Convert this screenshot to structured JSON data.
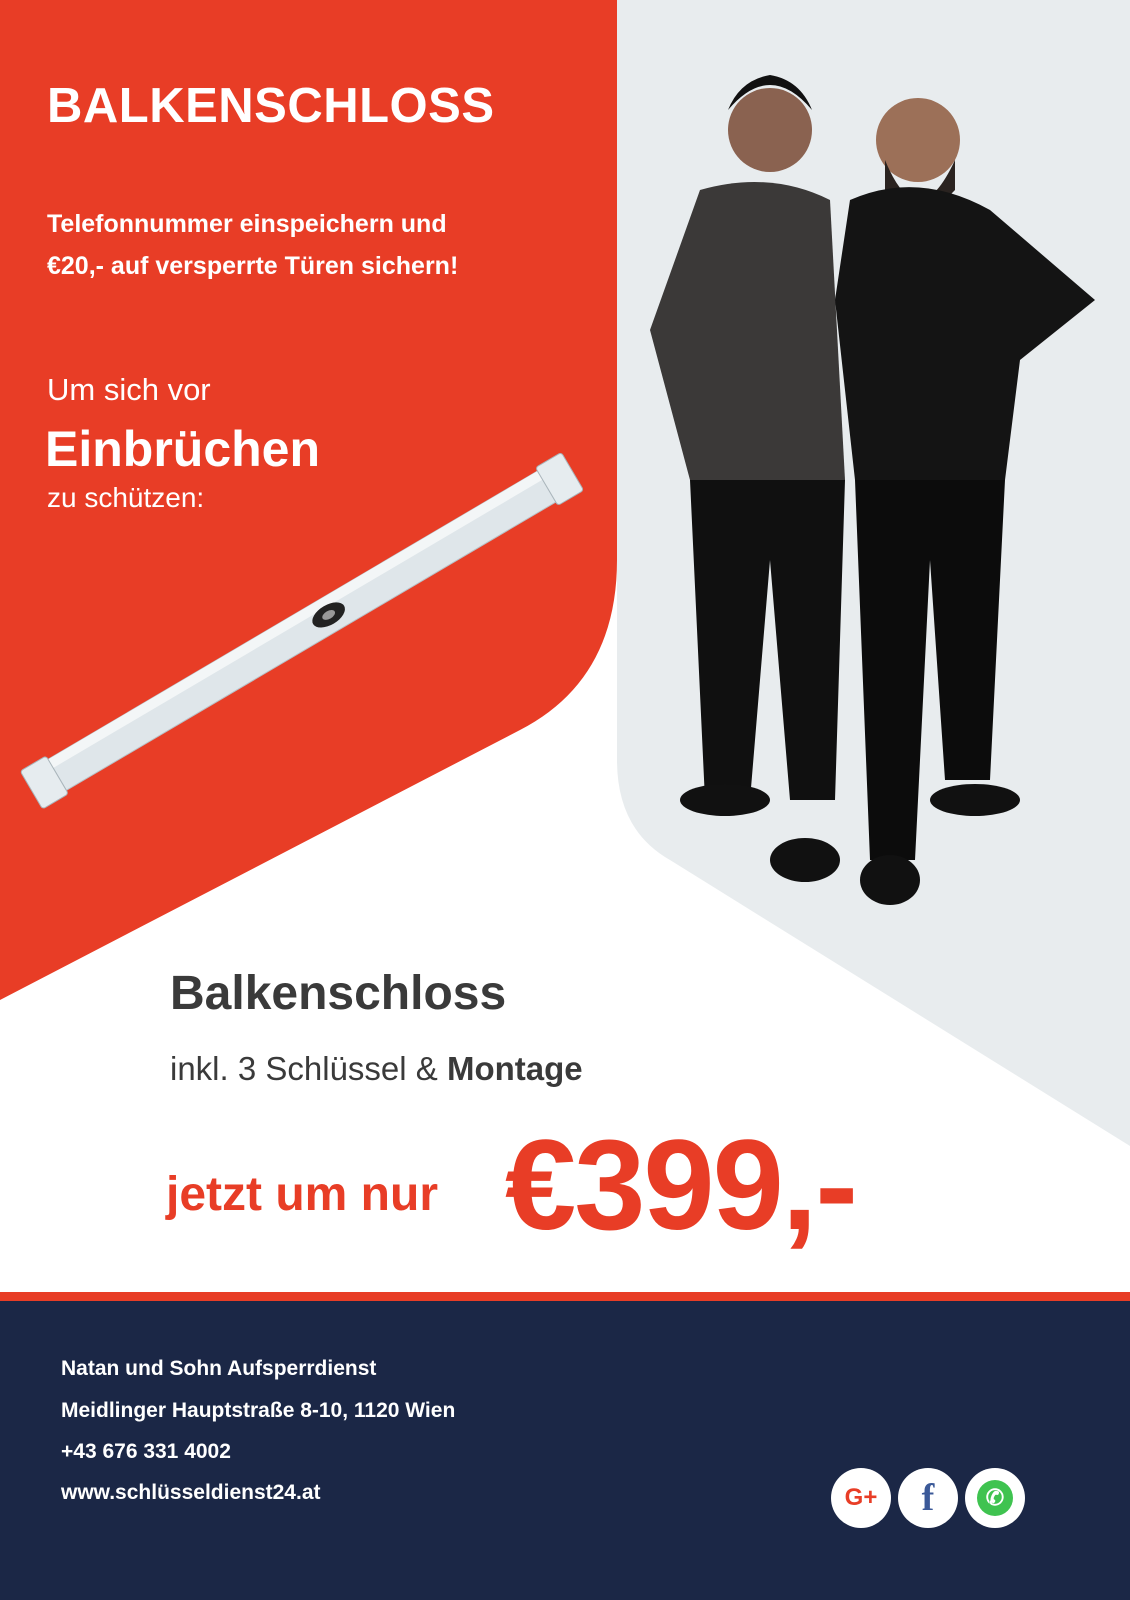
{
  "header": {
    "title": "BALKENSCHLOSS",
    "promo": "Telefonnummer einspeichern und €20,- auf versperrte Türen sichern!",
    "line1": "Um sich vor",
    "line2": "Einbrüchen",
    "line3": "zu schützen:"
  },
  "product": {
    "name": "Balkenschloss",
    "includes": "inkl. 3 Schlüssel & ",
    "includes_bold": "Montage",
    "price_lead": "jetzt um nur",
    "price": "€399,-"
  },
  "footer": {
    "company": "Natan und Sohn Aufsperrdienst",
    "address": "Meidlinger Hauptstraße 8-10, 1120 Wien",
    "phone": "+43 676 331 4002",
    "website": "www.schlüsseldienst24.at"
  },
  "social": {
    "google": "G+",
    "facebook": "f",
    "whatsapp": "✆"
  },
  "colors": {
    "red": "#e83d26",
    "navy": "#1b2746",
    "gray": "#e8ecee"
  }
}
